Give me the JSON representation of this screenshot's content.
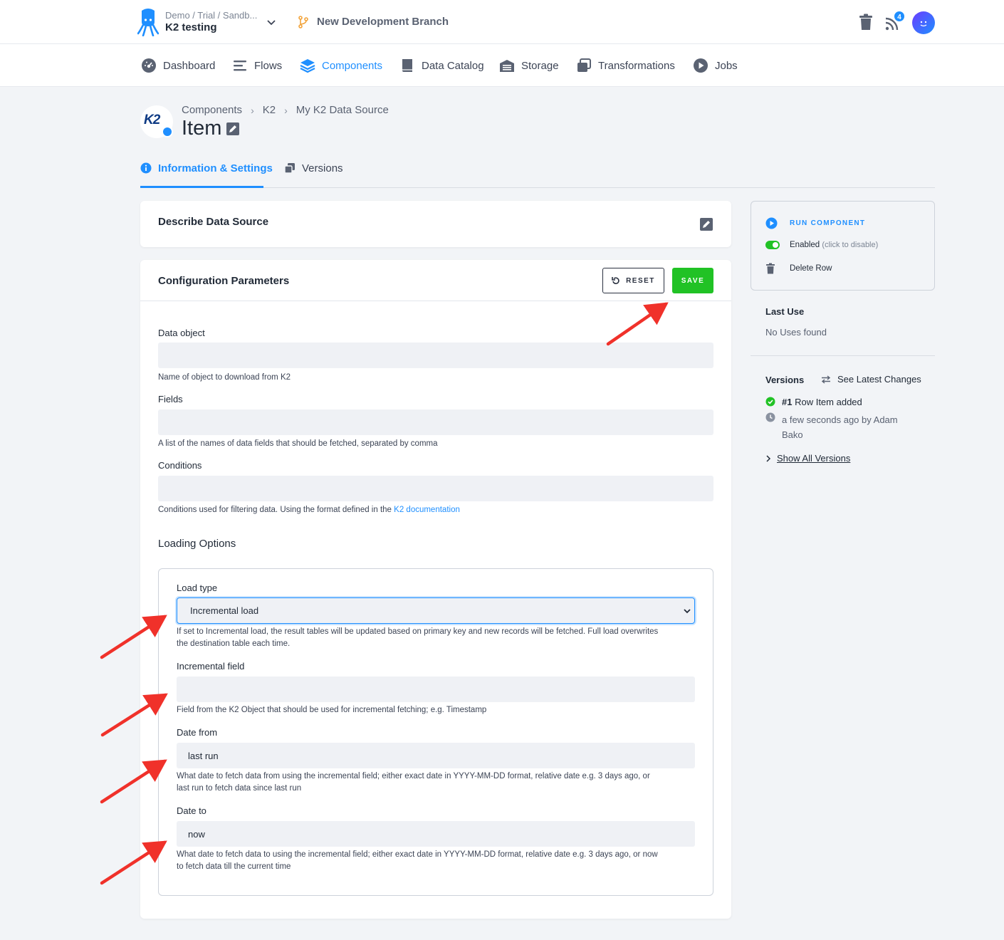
{
  "topbar": {
    "project_crumb": "Demo / Trial / Sandb...",
    "project_name": "K2 testing",
    "branch_label": "New Development Branch",
    "notifications_count": "4"
  },
  "nav": {
    "items": [
      {
        "label": "Dashboard",
        "icon": "dashboard-icon"
      },
      {
        "label": "Flows",
        "icon": "flows-icon"
      },
      {
        "label": "Components",
        "icon": "components-icon",
        "active": true
      },
      {
        "label": "Data Catalog",
        "icon": "book-icon"
      },
      {
        "label": "Storage",
        "icon": "storage-icon"
      },
      {
        "label": "Transformations",
        "icon": "transformations-icon"
      },
      {
        "label": "Jobs",
        "icon": "play-icon"
      }
    ]
  },
  "header": {
    "logo_text": "K2",
    "breadcrumb": [
      "Components",
      "K2",
      "My K2 Data Source"
    ],
    "title": "Item"
  },
  "tabs": {
    "info": "Information & Settings",
    "versions": "Versions"
  },
  "describe": {
    "title": "Describe Data Source"
  },
  "config": {
    "title": "Configuration Parameters",
    "reset_label": "RESET",
    "save_label": "SAVE",
    "data_object": {
      "label": "Data object",
      "value": "",
      "help": "Name of object to download from K2"
    },
    "fields": {
      "label": "Fields",
      "value": "",
      "help": "A list of the names of data fields that should be fetched, separated by comma"
    },
    "conditions": {
      "label": "Conditions",
      "value": "",
      "help": "Conditions used for filtering data. Using the format defined in the",
      "help_link": "K2 documentation"
    },
    "loading_title": "Loading Options",
    "load_type": {
      "label": "Load type",
      "value": "Incremental load",
      "help_1": "If set to Incremental load, the result tables will be updated based on primary key and new records will be fetched. Full load overwrites",
      "help_2": "the destination table each time."
    },
    "incremental_field": {
      "label": "Incremental field",
      "value": "",
      "help": "Field from the K2 Object that should be used for incremental fetching; e.g. Timestamp"
    },
    "date_from": {
      "label": "Date from",
      "value": "last run",
      "help_1": "What date to fetch data from using the incremental field; either exact date in YYYY-MM-DD format, relative date e.g. 3 days ago, or",
      "help_2": "last run to fetch data since last run"
    },
    "date_to": {
      "label": "Date to",
      "value": "now",
      "help_1": "What date to fetch data to using the incremental field; either exact date in YYYY-MM-DD format, relative date e.g. 3 days ago, or now",
      "help_2": "to fetch data till the current time"
    }
  },
  "sidebar": {
    "run_label": "RUN COMPONENT",
    "enabled_label": "Enabled",
    "enabled_hint": "(click to disable)",
    "delete_label": "Delete Row",
    "last_use_title": "Last Use",
    "last_use_value": "No Uses found",
    "versions_title": "Versions",
    "latest_changes": "See Latest Changes",
    "version_number": "#1",
    "version_desc": "Row Item added",
    "version_time_1": "a few seconds ago by Adam",
    "version_time_2": "Bako",
    "show_all": "Show All Versions"
  },
  "colors": {
    "accent": "#1f8fff",
    "save": "#21c225",
    "annotation_arrow": "#f0312a"
  }
}
